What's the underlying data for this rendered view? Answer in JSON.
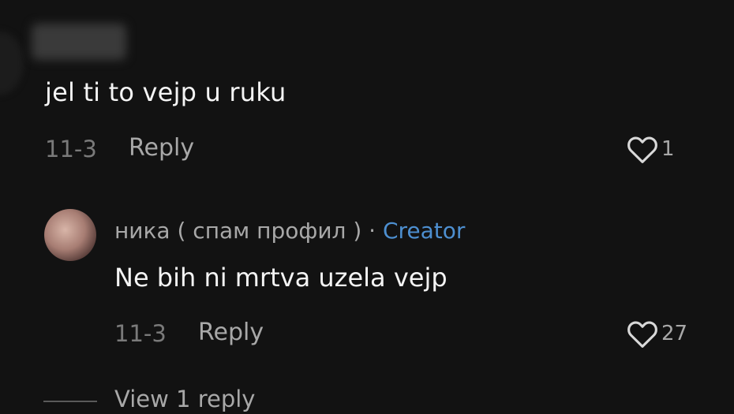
{
  "comment1": {
    "text": "jel ti to vejp u ruku",
    "date": "11-3",
    "reply_label": "Reply",
    "like_count": "1"
  },
  "comment2": {
    "username": "ника ( спам профил )",
    "separator": "·",
    "badge": "Creator",
    "text": "Ne bih ni mrtva uzela vejp",
    "date": "11-3",
    "reply_label": "Reply",
    "like_count": "27"
  },
  "view_replies_label": "View 1 reply",
  "colors": {
    "background": "#121212",
    "creator_badge": "#4d8fd0",
    "secondary_text": "#a8a8a8"
  },
  "icons": {
    "like": "heart-outline-icon"
  }
}
